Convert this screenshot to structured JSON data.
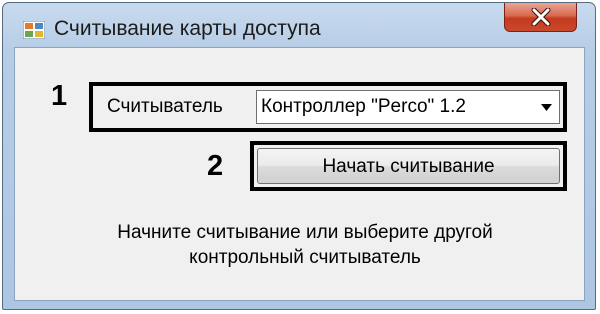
{
  "window": {
    "title": "Считывание карты доступа",
    "icon": "app-window-icon",
    "close_icon": "close-icon"
  },
  "markers": {
    "step1": "1",
    "step2": "2"
  },
  "reader": {
    "label": "Считыватель",
    "selected": "Контроллер \"Perco\" 1.2"
  },
  "start_button": {
    "label": "Начать считывание"
  },
  "hint": {
    "line1": "Начните считывание или выберите другой",
    "line2": "контрольный считыватель"
  },
  "colors": {
    "title_bar": "#b6cde6",
    "client_bg": "#f0f0f0",
    "close_button": "#c9482d"
  }
}
